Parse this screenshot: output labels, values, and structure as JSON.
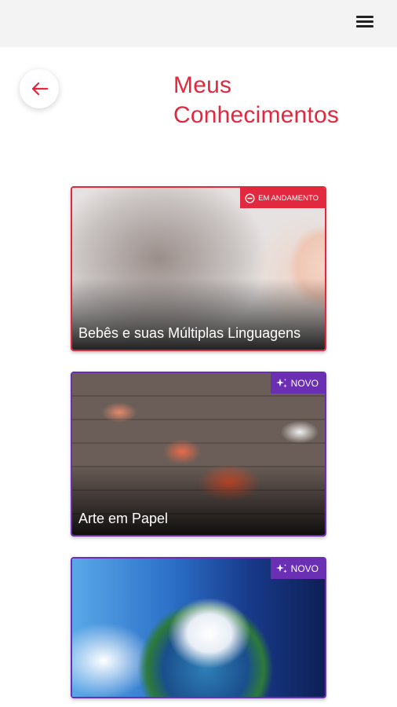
{
  "header": {
    "menu_icon": "hamburger-menu-icon"
  },
  "page": {
    "back_icon": "arrow-left-icon",
    "title_line1": "Meus",
    "title_line2": "Conhecimentos"
  },
  "colors": {
    "accent": "#e2283f",
    "new_badge": "#6b2fb3",
    "topbar": "#f3f3f3"
  },
  "courses": [
    {
      "title": "Bebês e suas Múltiplas Linguagens",
      "badge": "EM ANDAMENTO",
      "badge_icon": "in-progress-icon",
      "status": "in_progress"
    },
    {
      "title": "Arte em Papel",
      "badge": "NOVO",
      "badge_icon": "sparkle-icon",
      "status": "new"
    },
    {
      "title": "",
      "badge": "NOVO",
      "badge_icon": "sparkle-icon",
      "status": "new"
    }
  ]
}
